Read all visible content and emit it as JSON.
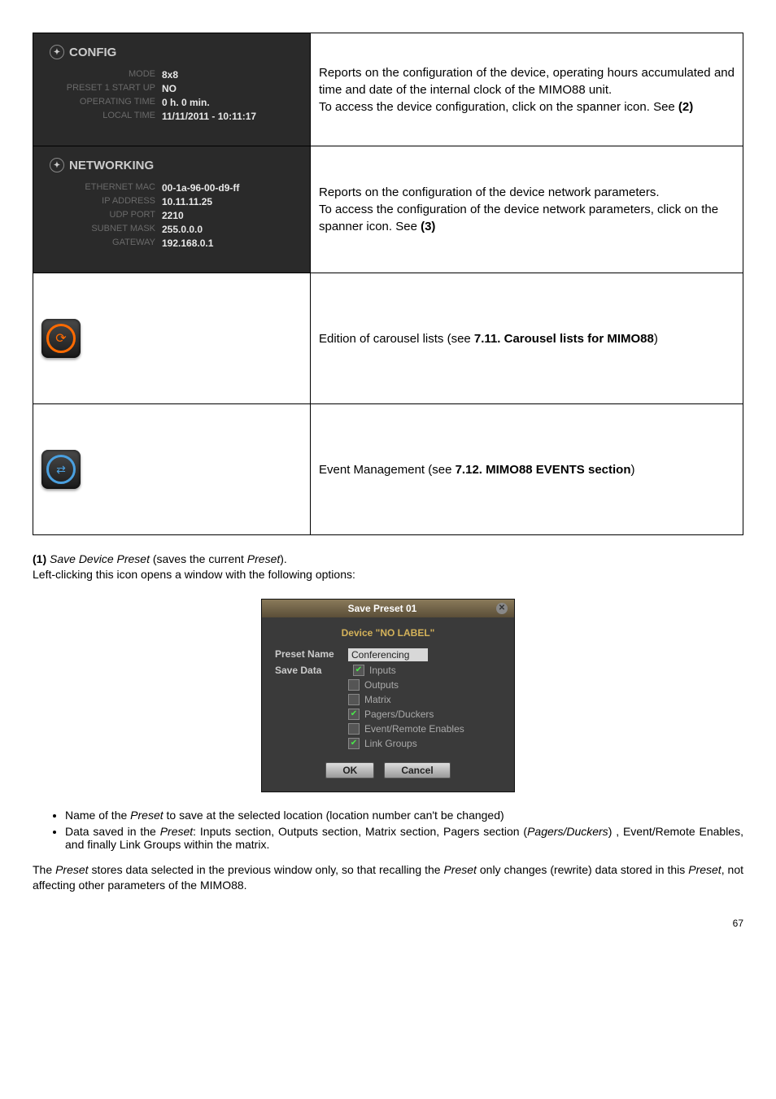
{
  "config_panel": {
    "title": "CONFIG",
    "rows": [
      {
        "label": "MODE",
        "value": "8x8"
      },
      {
        "label": "PRESET 1 START UP",
        "value": "NO"
      },
      {
        "label": "OPERATING TIME",
        "value": "0 h. 0 min."
      },
      {
        "label": "LOCAL TIME",
        "value": "11/11/2011 - 10:11:17"
      }
    ]
  },
  "config_desc": "Reports on the configuration of the device, operating hours accumulated and time and date of the internal clock of the MIMO88 unit.\nTo access the device configuration, click on the spanner icon. See (2)",
  "network_panel": {
    "title": "NETWORKING",
    "rows": [
      {
        "label": "ETHERNET MAC",
        "value": "00-1a-96-00-d9-ff"
      },
      {
        "label": "IP ADDRESS",
        "value": "10.11.11.25"
      },
      {
        "label": "UDP PORT",
        "value": "2210"
      },
      {
        "label": "SUBNET MASK",
        "value": "255.0.0.0"
      },
      {
        "label": "GATEWAY",
        "value": "192.168.0.1"
      }
    ]
  },
  "network_desc": "Reports on the configuration of the device network parameters. To access the configuration of the device network parameters, click on the spanner icon. See (3)",
  "carousel_desc": "Edition of carousel lists (see 7.11. Carousel lists for MIMO88)",
  "events_desc": "Event Management (see 7.12. MIMO88 EVENTS section)",
  "note1_bold": "(1)",
  "note1_italic": " Save Device Preset ",
  "note1_rest": "(saves the current ",
  "note1_preset": "Preset",
  "note1_end": ").",
  "note2": "Left-clicking this icon opens a window with the following options:",
  "dialog": {
    "title": "Save Preset 01",
    "device": "Device \"NO LABEL\"",
    "preset_label": "Preset Name",
    "preset_value": "Conferencing",
    "save_label": "Save Data",
    "options": [
      {
        "label": "Inputs",
        "checked": true
      },
      {
        "label": "Outputs",
        "checked": false
      },
      {
        "label": "Matrix",
        "checked": false
      },
      {
        "label": "Pagers/Duckers",
        "checked": true
      },
      {
        "label": "Event/Remote Enables",
        "checked": false
      },
      {
        "label": "Link Groups",
        "checked": true
      }
    ],
    "ok": "OK",
    "cancel": "Cancel"
  },
  "bullets": [
    "Name of the Preset to save at the selected location (location number can't be changed)",
    "Data saved in the Preset: Inputs section, Outputs section, Matrix section, Pagers section (Pagers/Duckers) , Event/Remote Enables, and finally Link Groups within the matrix."
  ],
  "final_para": "The Preset stores data selected in the previous window only, so that recalling the Preset only changes (rewrite) data stored in this Preset, not affecting other parameters of the MIMO88.",
  "page_number": "67"
}
